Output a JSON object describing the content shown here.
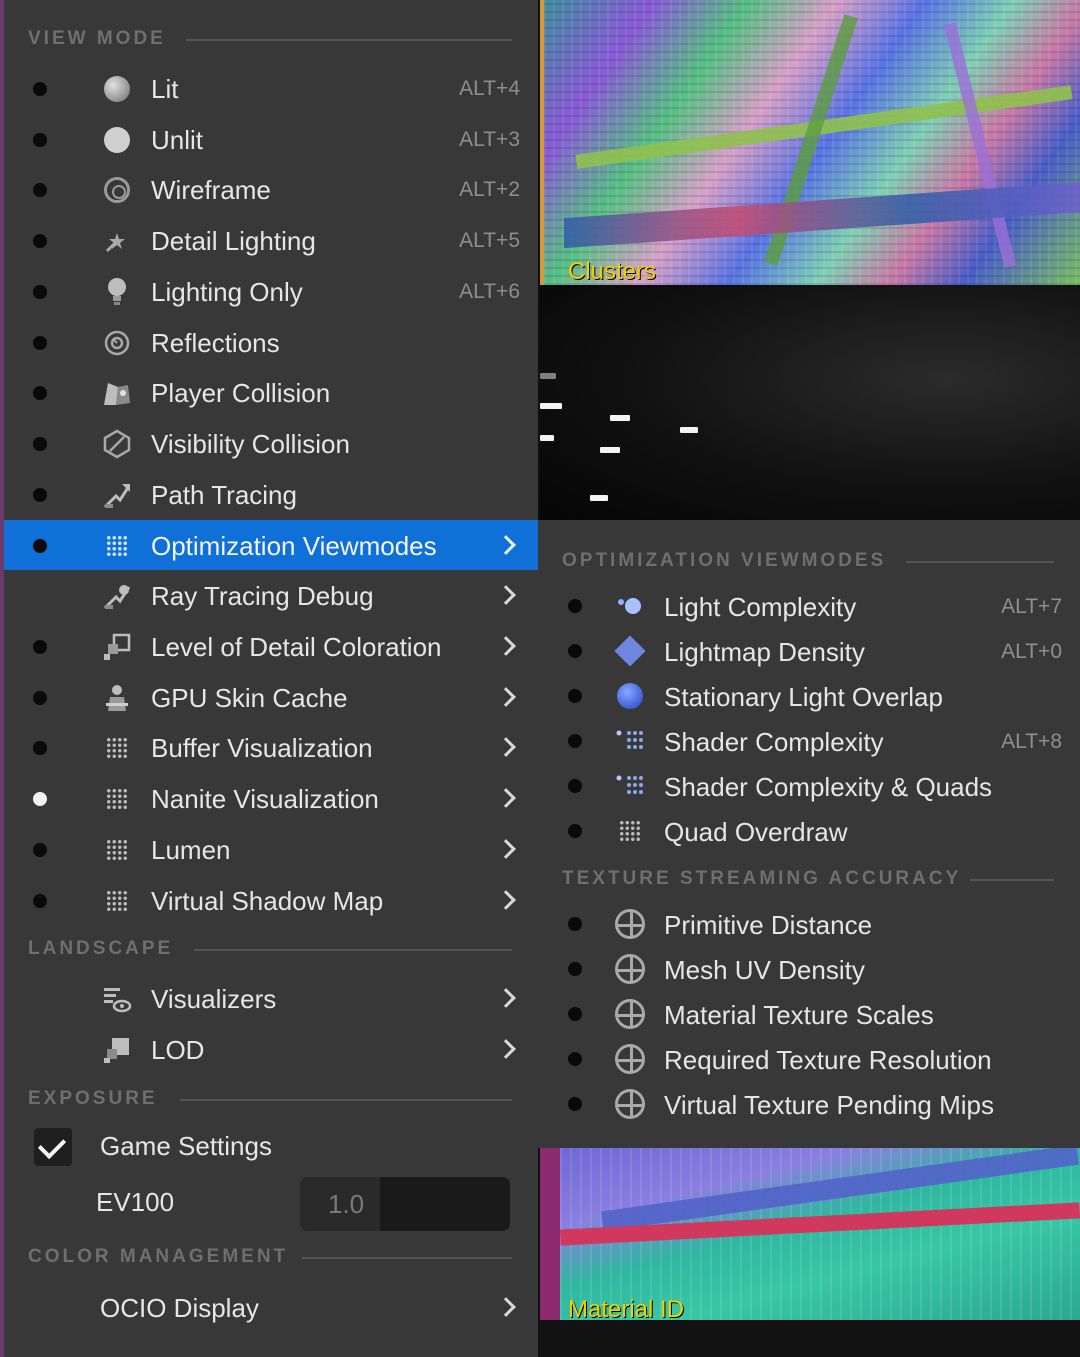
{
  "viewport": {
    "top_label": "Clusters",
    "bottom_label": "Material ID"
  },
  "main_menu": {
    "sections": {
      "view_mode": "VIEW MODE",
      "landscape": "LANDSCAPE",
      "exposure": "EXPOSURE",
      "color_management": "COLOR MANAGEMENT"
    },
    "view_mode_items": [
      {
        "label": "Lit",
        "shortcut": "ALT+4",
        "icon": "lit-sphere-icon"
      },
      {
        "label": "Unlit",
        "shortcut": "ALT+3",
        "icon": "unlit-sphere-icon"
      },
      {
        "label": "Wireframe",
        "shortcut": "ALT+2",
        "icon": "wireframe-icon"
      },
      {
        "label": "Detail Lighting",
        "shortcut": "ALT+5",
        "icon": "detail-lighting-icon"
      },
      {
        "label": "Lighting Only",
        "shortcut": "ALT+6",
        "icon": "light-bulb-icon"
      },
      {
        "label": "Reflections",
        "shortcut": "",
        "icon": "reflections-icon"
      },
      {
        "label": "Player Collision",
        "shortcut": "",
        "icon": "player-collision-icon"
      },
      {
        "label": "Visibility Collision",
        "shortcut": "",
        "icon": "visibility-collision-icon"
      },
      {
        "label": "Path Tracing",
        "shortcut": "",
        "icon": "path-tracing-icon"
      },
      {
        "label": "Optimization Viewmodes",
        "shortcut": "",
        "icon": "grid-icon"
      },
      {
        "label": "Ray Tracing Debug",
        "shortcut": "",
        "icon": "ray-tracing-icon"
      },
      {
        "label": "Level of Detail Coloration",
        "shortcut": "",
        "icon": "lod-coloration-icon"
      },
      {
        "label": "GPU Skin Cache",
        "shortcut": "",
        "icon": "skin-cache-icon"
      },
      {
        "label": "Buffer Visualization",
        "shortcut": "",
        "icon": "grid-icon"
      },
      {
        "label": "Nanite Visualization",
        "shortcut": "",
        "icon": "grid-icon"
      },
      {
        "label": "Lumen",
        "shortcut": "",
        "icon": "grid-icon"
      },
      {
        "label": "Virtual Shadow Map",
        "shortcut": "",
        "icon": "grid-icon"
      }
    ],
    "landscape_items": [
      {
        "label": "Visualizers",
        "icon": "visualizers-icon"
      },
      {
        "label": "LOD",
        "icon": "lod-icon"
      }
    ],
    "exposure": {
      "game_settings_label": "Game Settings",
      "game_settings_checked": true,
      "ev100_label": "EV100",
      "ev100_value": "1.0"
    },
    "color_management": {
      "ocio_label": "OCIO Display"
    }
  },
  "sub_menu": {
    "sections": {
      "optimization": "OPTIMIZATION VIEWMODES",
      "texture_streaming": "TEXTURE STREAMING ACCURACY"
    },
    "optimization_items": [
      {
        "label": "Light Complexity",
        "shortcut": "ALT+7",
        "icon": "light-complexity-icon"
      },
      {
        "label": "Lightmap Density",
        "shortcut": "ALT+0",
        "icon": "lightmap-density-icon"
      },
      {
        "label": "Stationary Light Overlap",
        "shortcut": "",
        "icon": "stationary-light-icon"
      },
      {
        "label": "Shader Complexity",
        "shortcut": "ALT+8",
        "icon": "shader-complexity-icon"
      },
      {
        "label": "Shader Complexity & Quads",
        "shortcut": "",
        "icon": "shader-complexity-quads-icon"
      },
      {
        "label": "Quad Overdraw",
        "shortcut": "",
        "icon": "quad-overdraw-icon"
      }
    ],
    "texture_items": [
      {
        "label": "Primitive Distance",
        "icon": "crosshair-icon"
      },
      {
        "label": "Mesh UV Density",
        "icon": "crosshair-icon"
      },
      {
        "label": "Material Texture Scales",
        "icon": "crosshair-icon"
      },
      {
        "label": "Required Texture Resolution",
        "icon": "crosshair-icon"
      },
      {
        "label": "Virtual Texture Pending Mips",
        "icon": "crosshair-icon"
      }
    ]
  },
  "colors": {
    "menu_bg": "#383838",
    "highlight": "#0f70d8",
    "viewport_label": "#f3d000"
  }
}
